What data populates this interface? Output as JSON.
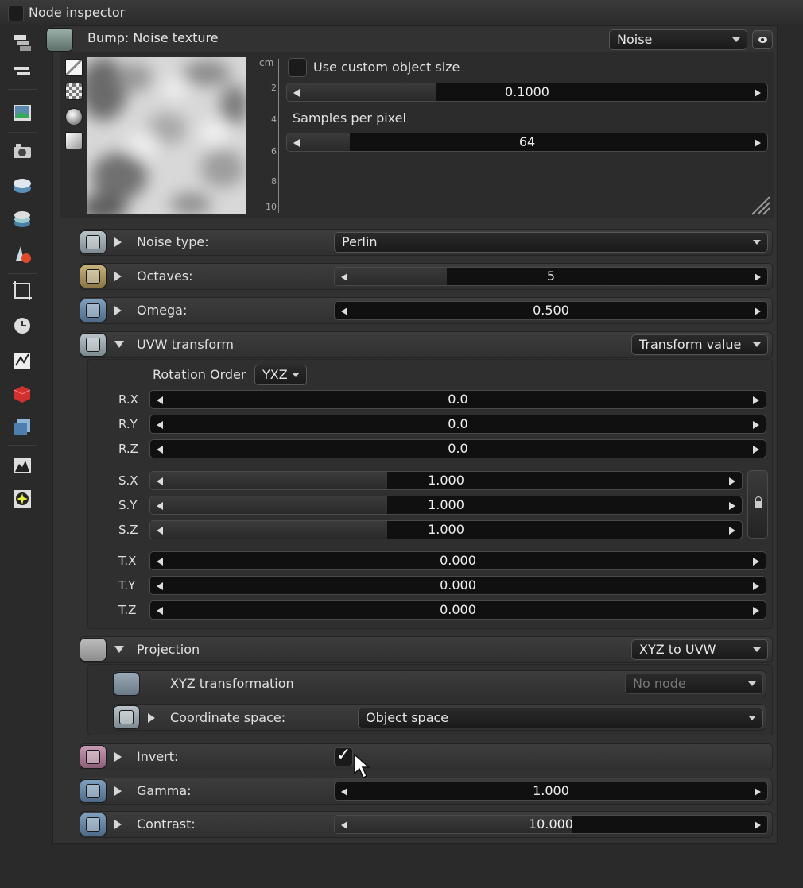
{
  "window": {
    "title": "Node inspector"
  },
  "node": {
    "title": "Bump: Noise texture",
    "type_select": "Noise"
  },
  "preview": {
    "ruler_unit": "cm",
    "ruler_ticks": [
      "2",
      "4",
      "6",
      "8",
      "10"
    ],
    "use_custom_size_label": "Use custom object size",
    "object_size_value": "0.1000",
    "object_size_fraction": 0.31,
    "samples_label": "Samples per pixel",
    "samples_value": "64",
    "samples_fraction": 0.13
  },
  "params": {
    "noise_type": {
      "label": "Noise type:",
      "value": "Perlin"
    },
    "octaves": {
      "label": "Octaves:",
      "value": "5",
      "fraction": 0.26
    },
    "omega": {
      "label": "Omega:",
      "value": "0.500"
    },
    "uvw": {
      "label": "UVW transform",
      "mode": "Transform value",
      "rotation_order_label": "Rotation Order",
      "rotation_order": "YXZ",
      "rx": {
        "label": "R.X",
        "value": "0.0"
      },
      "ry": {
        "label": "R.Y",
        "value": "0.0"
      },
      "rz": {
        "label": "R.Z",
        "value": "0.0"
      },
      "sx": {
        "label": "S.X",
        "value": "1.000"
      },
      "sy": {
        "label": "S.Y",
        "value": "1.000"
      },
      "sz": {
        "label": "S.Z",
        "value": "1.000"
      },
      "tx": {
        "label": "T.X",
        "value": "0.000"
      },
      "ty": {
        "label": "T.Y",
        "value": "0.000"
      },
      "tz": {
        "label": "T.Z",
        "value": "0.000"
      }
    },
    "projection": {
      "label": "Projection",
      "mode": "XYZ to UVW",
      "xyz_transform_label": "XYZ transformation",
      "xyz_transform_value": "No node",
      "coord_space_label": "Coordinate space:",
      "coord_space_value": "Object space"
    },
    "invert": {
      "label": "Invert:",
      "checked": true,
      "check_glyph": "✓"
    },
    "gamma": {
      "label": "Gamma:",
      "value": "1.000"
    },
    "contrast": {
      "label": "Contrast:",
      "value": "10.000",
      "fraction": 0.55
    }
  },
  "colors": {
    "panel_bg": "#323232",
    "accent_red": "#d03030",
    "accent_blue": "#4d6a88"
  }
}
